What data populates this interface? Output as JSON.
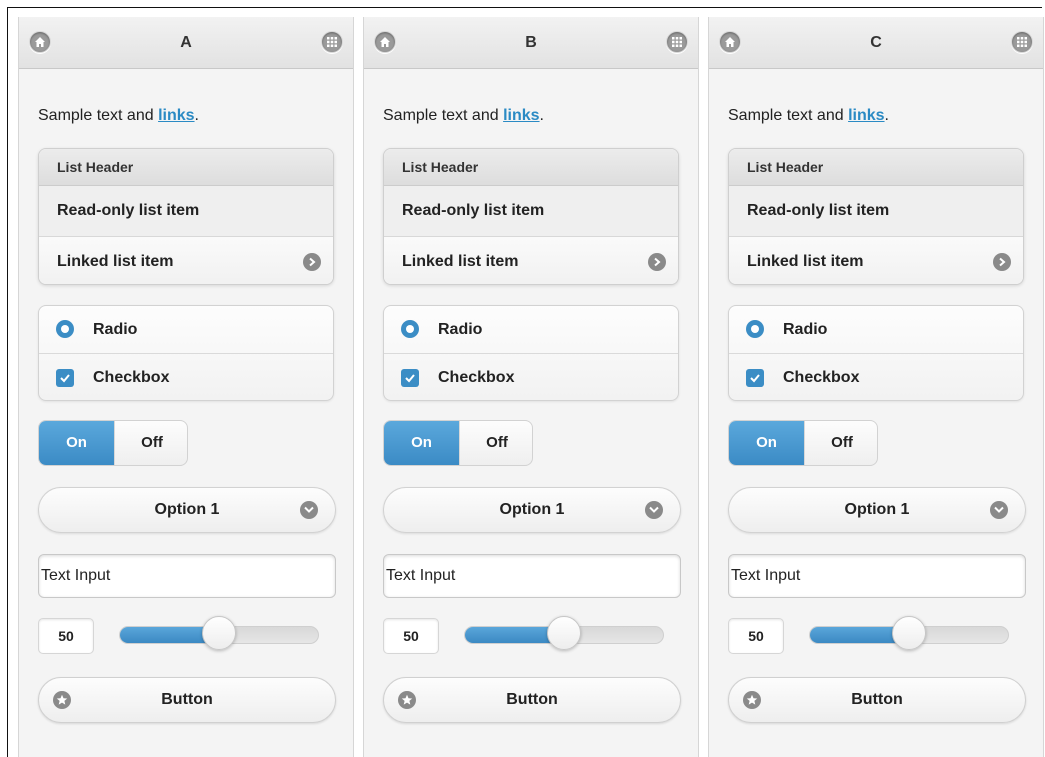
{
  "panels": [
    {
      "title": "A",
      "sample_text": "Sample text and ",
      "link_text": "links",
      "period": ".",
      "list_header": "List Header",
      "readonly_item": "Read-only list item",
      "linked_item": "Linked list item",
      "radio_label": "Radio",
      "checkbox_label": "Checkbox",
      "flip_on": "On",
      "flip_off": "Off",
      "select_value": "Option 1",
      "text_input_value": "Text Input",
      "slider_value": "50",
      "button_label": "Button"
    },
    {
      "title": "B",
      "sample_text": "Sample text and ",
      "link_text": "links",
      "period": ".",
      "list_header": "List Header",
      "readonly_item": "Read-only list item",
      "linked_item": "Linked list item",
      "radio_label": "Radio",
      "checkbox_label": "Checkbox",
      "flip_on": "On",
      "flip_off": "Off",
      "select_value": "Option 1",
      "text_input_value": "Text Input",
      "slider_value": "50",
      "button_label": "Button"
    },
    {
      "title": "C",
      "sample_text": "Sample text and ",
      "link_text": "links",
      "period": ".",
      "list_header": "List Header",
      "readonly_item": "Read-only list item",
      "linked_item": "Linked list item",
      "radio_label": "Radio",
      "checkbox_label": "Checkbox",
      "flip_on": "On",
      "flip_off": "Off",
      "select_value": "Option 1",
      "text_input_value": "Text Input",
      "slider_value": "50",
      "button_label": "Button"
    }
  ],
  "slider": {
    "min": 0,
    "max": 100
  },
  "colors": {
    "accent": "#3b8dc5",
    "link": "#2a8ac4",
    "icon_gray": "#8a8a8a"
  },
  "icons": {
    "header_left": "home-icon",
    "header_right": "grid-icon",
    "linked_item": "arrow-right-icon",
    "select": "chevron-down-icon",
    "button": "star-icon"
  }
}
